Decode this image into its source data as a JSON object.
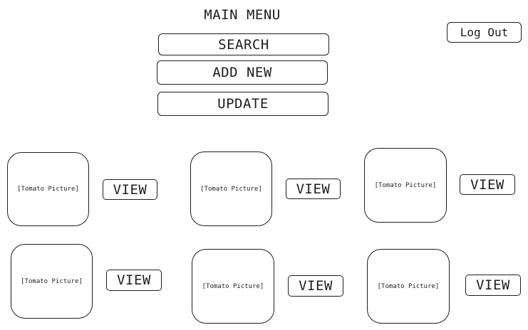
{
  "header": {
    "title": "MAIN MENU",
    "logout_label": "Log Out"
  },
  "menu": {
    "search_label": "SEARCH",
    "add_new_label": "ADD NEW",
    "update_label": "UPDATE"
  },
  "grid": {
    "items": [
      {
        "picture": "[Tomato Picture]",
        "view": "VIEW"
      },
      {
        "picture": "[Tomato Picture]",
        "view": "VIEW"
      },
      {
        "picture": "[Tomato Picture]",
        "view": "VIEW"
      },
      {
        "picture": "[Tomato Picture]",
        "view": "VIEW"
      },
      {
        "picture": "[Tomato Picture]",
        "view": "VIEW"
      },
      {
        "picture": "[Tomato Picture]",
        "view": "VIEW"
      }
    ]
  }
}
